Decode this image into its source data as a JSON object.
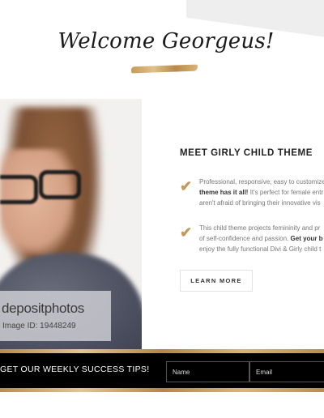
{
  "hero": {
    "title": "Welcome Georgeus!"
  },
  "watermark": {
    "brand": "depositphotos",
    "image_id": "Image ID:  19448249"
  },
  "feature": {
    "heading": "MEET GIRLY CHILD THEME",
    "items": [
      {
        "icon": "checkmark-icon",
        "lines": [
          {
            "text": "Professional, responsive, easy to customize",
            "bold": ""
          },
          {
            "text": " It's perfect for female entr",
            "bold": "theme has it all!"
          },
          {
            "text": "aren't afraid of bringing their innovative vis",
            "bold": ""
          }
        ]
      },
      {
        "icon": "checkmark-icon",
        "lines": [
          {
            "text": "This child theme projects femininity and pr",
            "bold": ""
          },
          {
            "text": "of self-confidence and passion. ",
            "bold": "Get your b"
          },
          {
            "text": "enjoy the fully functional Divi & Girly child t",
            "bold": ""
          }
        ]
      }
    ],
    "button_label": "LEARN MORE"
  },
  "newsletter": {
    "text": "GET OUR WEEKLY SUCCESS TIPS!",
    "name_placeholder": "Name",
    "email_placeholder": "Email"
  },
  "colors": {
    "accent": "#c49a5a",
    "bar": "#000000"
  }
}
